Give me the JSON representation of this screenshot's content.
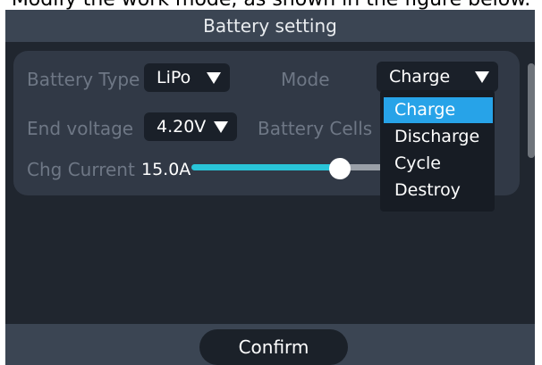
{
  "caption": "Modify the work mode, as shown in the figure below.",
  "title": "Battery setting",
  "fields": {
    "battery_type": {
      "label": "Battery Type",
      "value": "LiPo"
    },
    "mode": {
      "label": "Mode",
      "value": "Charge"
    },
    "end_voltage": {
      "label": "End voltage",
      "value": "4.20V"
    },
    "battery_cells": {
      "label": "Battery Cells"
    },
    "chg_current": {
      "label": "Chg Current",
      "value": "15.0A",
      "slider_fraction": 0.48
    }
  },
  "mode_menu": {
    "selected": "Charge",
    "options": [
      "Charge",
      "Discharge",
      "Cycle",
      "Destroy"
    ]
  },
  "confirm_label": "Confirm",
  "colors": {
    "background": "#20262f",
    "panel": "#313946",
    "header": "#3b4553",
    "accent": "#29c5d9",
    "selected": "#27a3e8"
  }
}
